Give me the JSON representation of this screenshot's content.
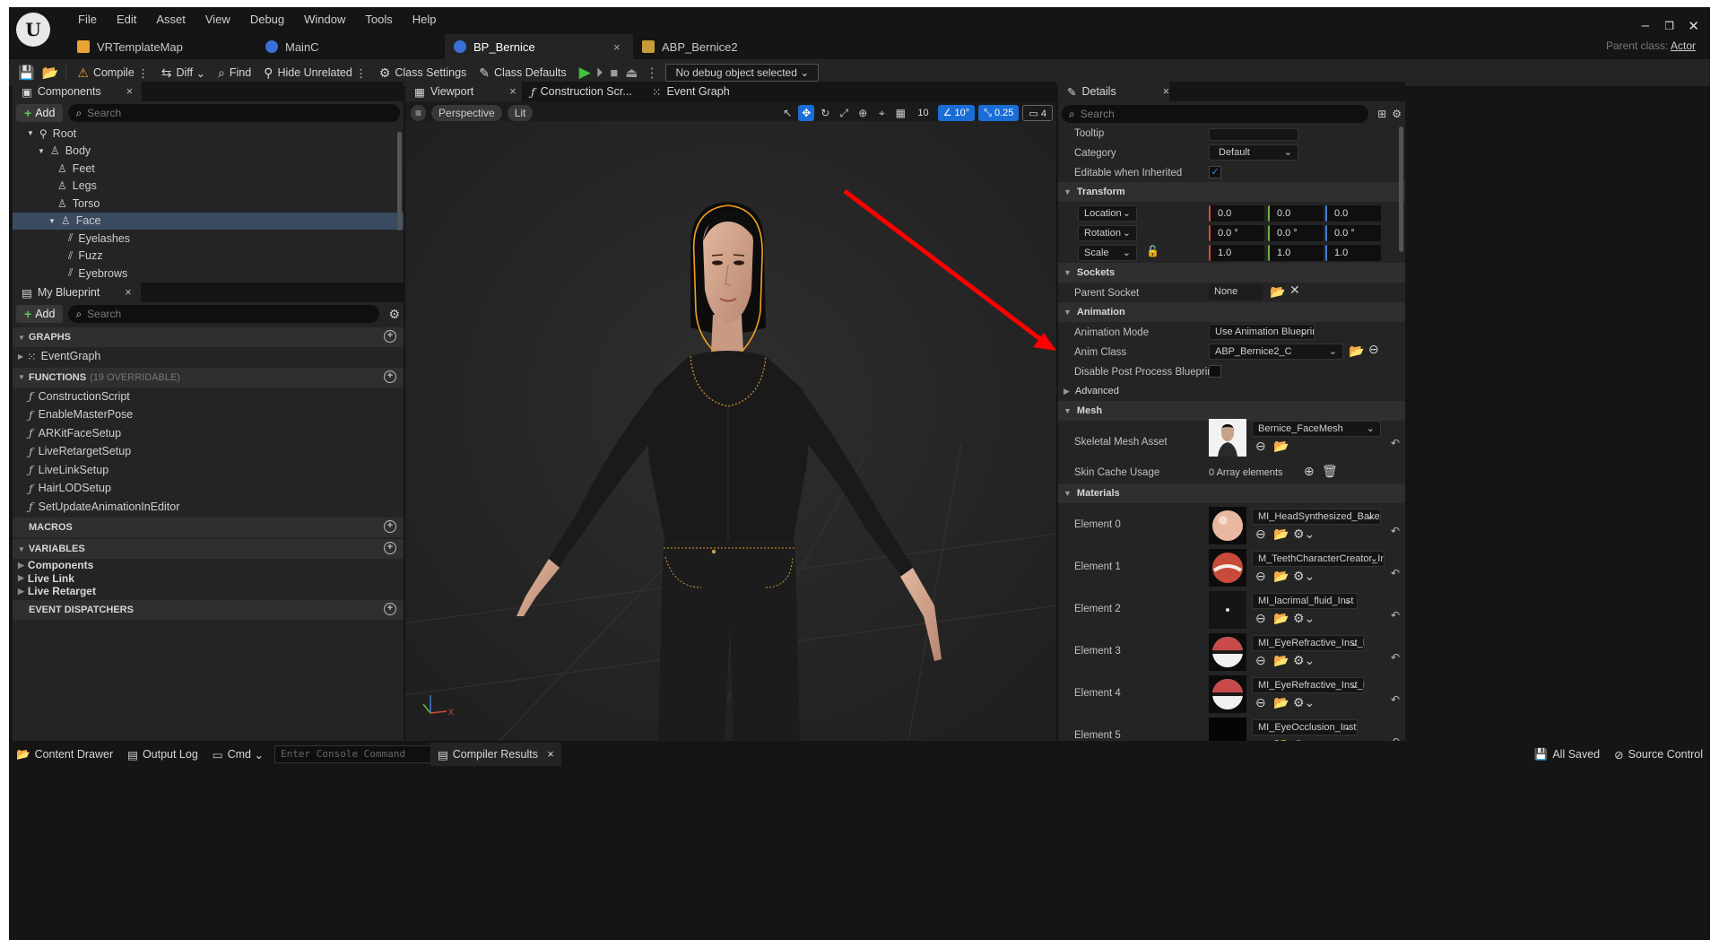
{
  "menu": [
    "File",
    "Edit",
    "Asset",
    "View",
    "Debug",
    "Window",
    "Tools",
    "Help"
  ],
  "doc_tabs": [
    {
      "label": "VRTemplateMap",
      "color": "#e8a531"
    },
    {
      "label": "MainC",
      "color": "#3a6fd8"
    },
    {
      "label": "BP_Bernice",
      "color": "#3a6fd8"
    },
    {
      "label": "ABP_Bernice2",
      "color": "#c89b3a"
    }
  ],
  "close_glyph": "×",
  "parent_class": {
    "label": "Parent class:",
    "value": "Actor"
  },
  "toolbar": {
    "compile": "Compile",
    "diff": "Diff",
    "find": "Find",
    "hide_unrelated": "Hide Unrelated",
    "class_settings": "Class Settings",
    "class_defaults": "Class Defaults",
    "debug_object": "No debug object selected"
  },
  "components": {
    "tab": "Components",
    "add": "Add",
    "search_placeholder": "Search",
    "tree": [
      "Root",
      "Body",
      "Feet",
      "Legs",
      "Torso",
      "Face",
      "Eyelashes",
      "Fuzz",
      "Eyebrows"
    ]
  },
  "my_blueprint": {
    "tab": "My Blueprint",
    "add": "Add",
    "search_placeholder": "Search",
    "graphs_title": "GRAPHS",
    "event_graph": "EventGraph",
    "functions_title": "FUNCTIONS",
    "functions_sub": "(19 OVERRIDABLE)",
    "functions": [
      "ConstructionScript",
      "EnableMasterPose",
      "ARKitFaceSetup",
      "LiveRetargetSetup",
      "LiveLinkSetup",
      "HairLODSetup",
      "SetUpdateAnimationInEditor"
    ],
    "macros_title": "MACROS",
    "variables_title": "VARIABLES",
    "variables": [
      "Components",
      "Live Link",
      "Live Retarget"
    ],
    "event_dispatchers_title": "EVENT DISPATCHERS"
  },
  "center_tabs": [
    "Viewport",
    "Construction Scr...",
    "Event Graph"
  ],
  "viewport": {
    "perspective": "Perspective",
    "lit": "Lit",
    "grid_snap": "10",
    "angle_snap": "10°",
    "scale_snap": "0.25",
    "camera_speed": "4"
  },
  "details": {
    "tab": "Details",
    "search_placeholder": "Search",
    "tooltip_label": "Tooltip",
    "category_label": "Category",
    "category_value": "Default",
    "editable_label": "Editable when Inherited",
    "transform_title": "Transform",
    "location_label": "Location",
    "rotation_label": "Rotation",
    "scale_label": "Scale",
    "location": [
      "0.0",
      "0.0",
      "0.0"
    ],
    "rotation": [
      "0.0 °",
      "0.0 °",
      "0.0 °"
    ],
    "scale": [
      "1.0",
      "1.0",
      "1.0"
    ],
    "sockets_title": "Sockets",
    "parent_socket_label": "Parent Socket",
    "parent_socket_value": "None",
    "animation_title": "Animation",
    "animation_mode_label": "Animation Mode",
    "animation_mode_value": "Use Animation Blueprint",
    "anim_class_label": "Anim Class",
    "anim_class_value": "ABP_Bernice2_C",
    "disable_pp_label": "Disable Post Process Blueprint",
    "advanced_title": "Advanced",
    "mesh_title": "Mesh",
    "skeletal_mesh_label": "Skeletal Mesh Asset",
    "skeletal_mesh_value": "Bernice_FaceMesh",
    "skin_cache_label": "Skin Cache Usage",
    "skin_cache_value": "0 Array elements",
    "materials_title": "Materials",
    "materials": [
      {
        "label": "Element 0",
        "value": "MI_HeadSynthesized_Baked"
      },
      {
        "label": "Element 1",
        "value": "M_TeethCharacterCreator_Inst"
      },
      {
        "label": "Element 2",
        "value": "MI_lacrimal_fluid_Inst"
      },
      {
        "label": "Element 3",
        "value": "MI_EyeRefractive_Inst_L"
      },
      {
        "label": "Element 4",
        "value": "MI_EyeRefractive_Inst_R"
      },
      {
        "label": "Element 5",
        "value": "MI_EyeOcclusion_Inst"
      }
    ]
  },
  "bottom": {
    "content_drawer": "Content Drawer",
    "output_log": "Output Log",
    "cmd": "Cmd",
    "console_placeholder": "Enter Console Command",
    "compiler_results": "Compiler Results",
    "all_saved": "All Saved",
    "source_control": "Source Control"
  },
  "colors": {
    "accent_blue": "#1a6dd6",
    "annotation_arrow": "#ff0000",
    "selection_outline": "#f0a020"
  }
}
